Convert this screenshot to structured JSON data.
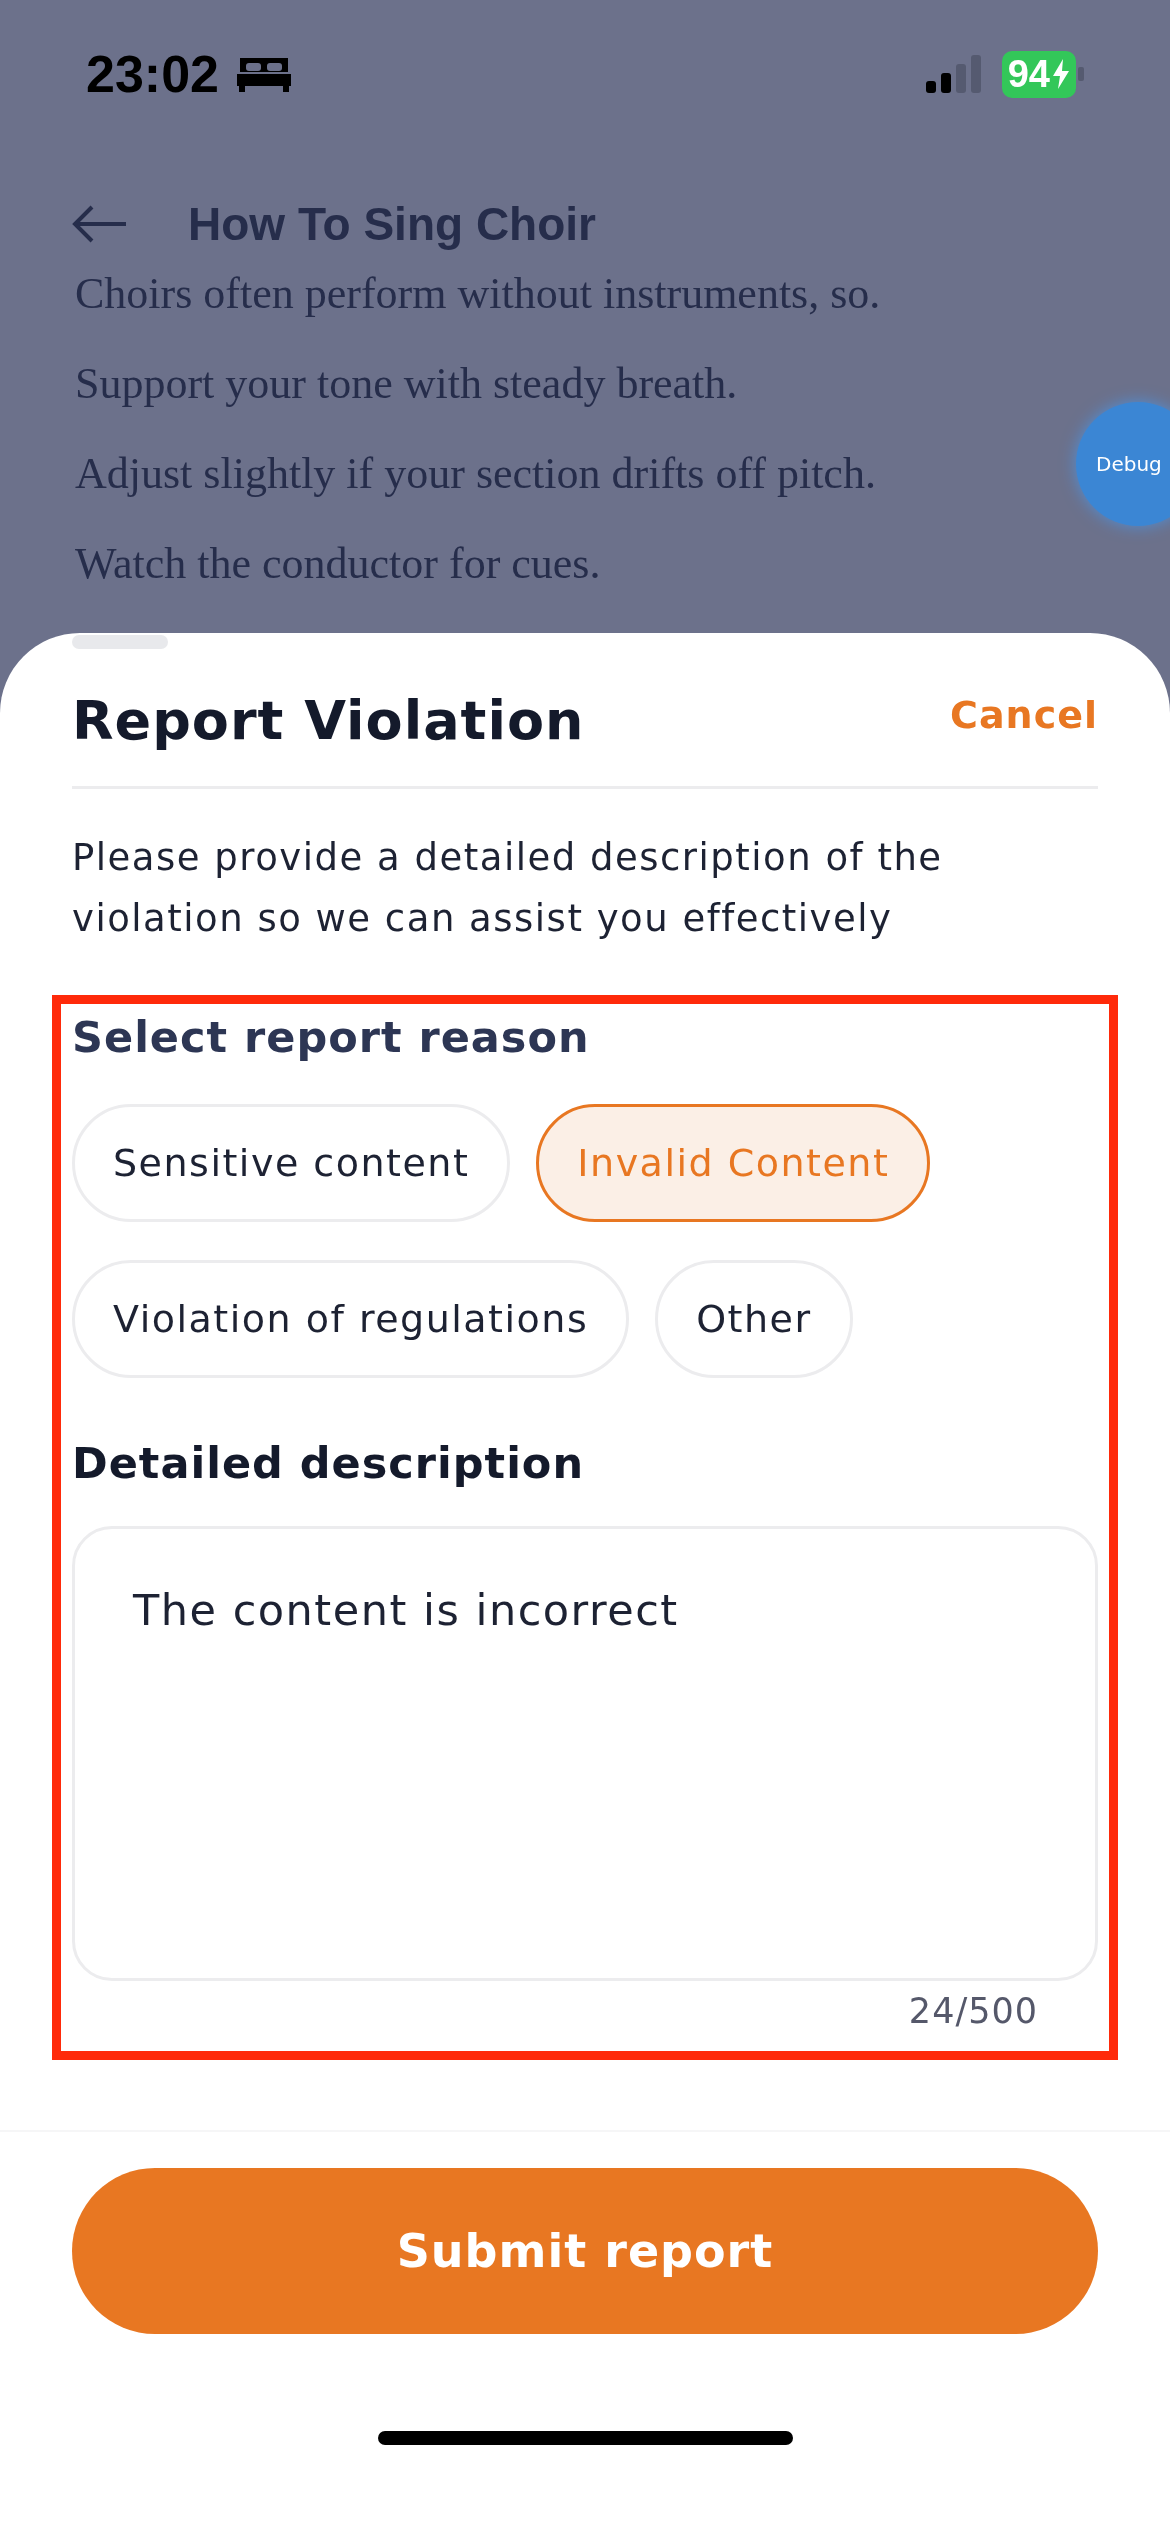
{
  "status_bar": {
    "time": "23:02",
    "battery": "94"
  },
  "header": {
    "title": "How To Sing Choir"
  },
  "article": {
    "lines": [
      "Choirs often perform without instruments, so.",
      "Support your tone with steady breath.",
      "Adjust slightly if your section drifts off pitch.",
      "Watch the conductor for cues."
    ]
  },
  "debug_button": {
    "label": "Debug"
  },
  "sheet": {
    "title": "Report Violation",
    "cancel": "Cancel",
    "intro": "Please provide a detailed description of the violation so we can assist you effectively",
    "reason_label": "Select report reason",
    "reasons": [
      {
        "label": "Sensitive content",
        "selected": false
      },
      {
        "label": "Invalid Content",
        "selected": true
      },
      {
        "label": "Violation of regulations",
        "selected": false
      },
      {
        "label": "Other",
        "selected": false
      }
    ],
    "description_label": "Detailed description",
    "description": {
      "value": "The content is incorrect",
      "counter": "24/500"
    },
    "submit": "Submit report"
  }
}
